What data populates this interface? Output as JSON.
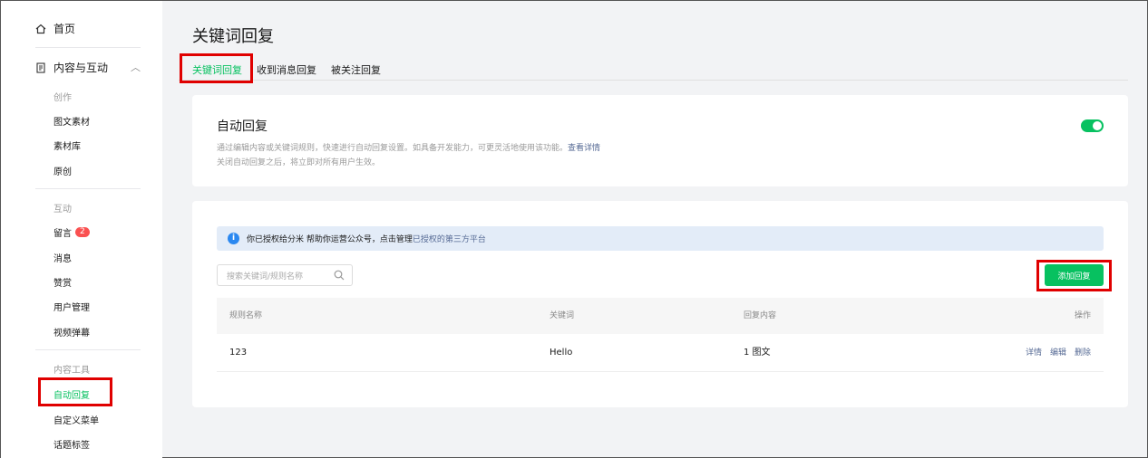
{
  "sidebar": {
    "home": "首页",
    "group": "内容与互动",
    "sections": [
      {
        "title": "创作",
        "items": [
          "图文素材",
          "素材库",
          "原创"
        ]
      },
      {
        "title": "互动",
        "items": [
          "留言",
          "消息",
          "赞赏",
          "用户管理",
          "视频弹幕"
        ]
      },
      {
        "title": "内容工具",
        "items": [
          "自动回复",
          "自定义菜单",
          "话题标签"
        ]
      }
    ],
    "comment_badge": "2"
  },
  "page": {
    "title": "关键词回复",
    "tabs": [
      "关键词回复",
      "收到消息回复",
      "被关注回复"
    ]
  },
  "auto_reply": {
    "title": "自动回复",
    "desc1": "通过编辑内容或关键词规则，快速进行自动回复设置。如具备开发能力，可更灵活地使用该功能。",
    "desc1_link": "查看详情",
    "desc2": "关闭自动回复之后，将立即对所有用户生效。",
    "enabled": true
  },
  "notice": {
    "text": "你已授权给分米 帮助你运营公众号，点击管理",
    "link": "已授权的第三方平台"
  },
  "search": {
    "placeholder": "搜索关键词/规则名称"
  },
  "add_button": "添加回复",
  "table": {
    "headers": [
      "规则名称",
      "关键词",
      "回复内容",
      "操作"
    ],
    "rows": [
      {
        "name": "123",
        "keyword": "Hello",
        "content": "1 图文",
        "ops": [
          "详情",
          "编辑",
          "删除"
        ]
      }
    ]
  },
  "colors": {
    "accent": "#07c160",
    "link": "#576b95",
    "badge": "#fa5151",
    "highlight_box": "#e00000"
  }
}
